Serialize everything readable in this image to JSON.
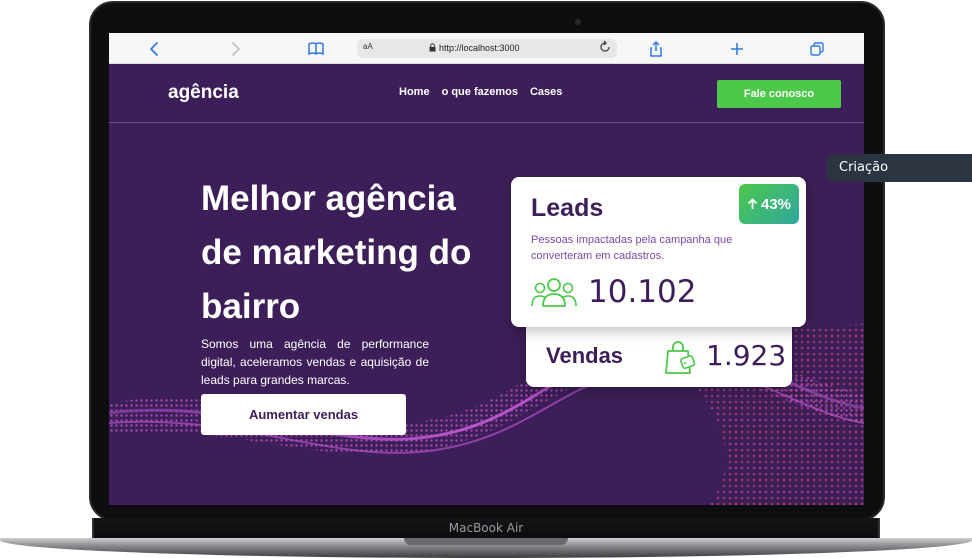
{
  "browser": {
    "url": "http://localhost:3000",
    "reader_label": "aA",
    "icons": [
      "back-icon",
      "forward-icon",
      "book-icon",
      "lock-icon",
      "reload-icon",
      "share-icon",
      "plus-icon",
      "tabs-icon"
    ]
  },
  "site": {
    "logo": "agência",
    "nav": [
      "Home",
      "o que fazemos",
      "Cases"
    ],
    "cta": "Fale conosco",
    "hero": {
      "title": "Melhor agência de marketing do bairro",
      "description": "Somos uma agência de performance digital, aceleramos vendas e aquisição de leads para grandes marcas.",
      "button": "Aumentar vendas"
    },
    "leads": {
      "title": "Leads",
      "badge": "43%",
      "subtitle": "Pessoas impactadas pela campanha que converteram em cadastros.",
      "value": "10.102"
    },
    "vendas": {
      "title": "Vendas",
      "value": "1.923"
    }
  },
  "tooltip": "Criação",
  "device_label": "MacBook Air",
  "colors": {
    "brand_purple": "#3c1f58",
    "accent_green": "#4cc84a",
    "wave_pink": "#d05ad0"
  }
}
